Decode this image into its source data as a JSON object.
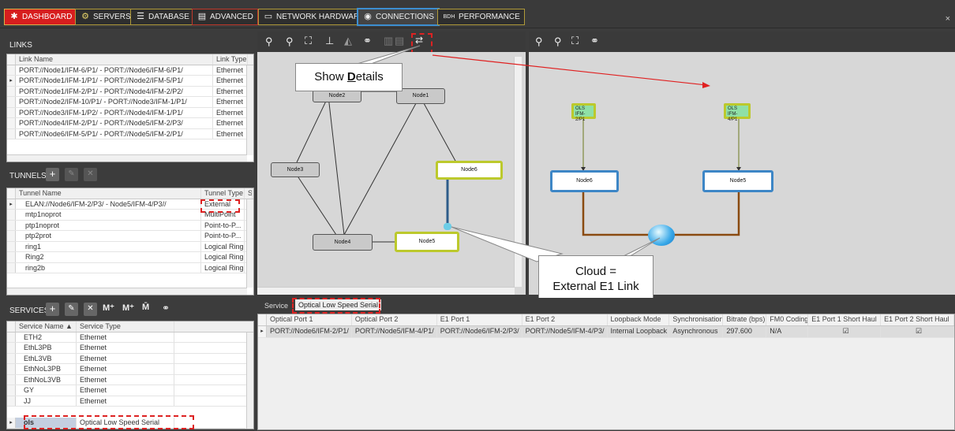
{
  "nav": [
    {
      "label": "DASHBOARD",
      "icon": "dashboard-icon"
    },
    {
      "label": "SERVERS",
      "icon": "gear-icon"
    },
    {
      "label": "DATABASE",
      "icon": "database-icon"
    },
    {
      "label": "ADVANCED",
      "icon": "document-icon"
    },
    {
      "label": "NETWORK HARDWARE",
      "icon": "network-icon"
    },
    {
      "label": "CONNECTIONS",
      "icon": "connections-icon"
    },
    {
      "label": "PERFORMANCE",
      "icon": "performance-icon"
    }
  ],
  "close": "×",
  "links": {
    "title": "LINKS",
    "columns": [
      "Link Name",
      "Link Type"
    ],
    "rows": [
      [
        "PORT://Node1/IFM-6/P1/ - PORT://Node6/IFM-6/P1/",
        "Ethernet"
      ],
      [
        "PORT://Node1/IFM-1/P1/ - PORT://Node2/IFM-5/P1/",
        "Ethernet"
      ],
      [
        "PORT://Node1/IFM-2/P1/ - PORT://Node4/IFM-2/P2/",
        "Ethernet"
      ],
      [
        "PORT://Node2/IFM-10/P1/ - PORT://Node3/IFM-1/P1/",
        "Ethernet"
      ],
      [
        "PORT://Node3/IFM-1/P2/ - PORT://Node4/IFM-1/P1/",
        "Ethernet"
      ],
      [
        "PORT://Node4/IFM-2/P1/ - PORT://Node5/IFM-2/P3/",
        "Ethernet"
      ],
      [
        "PORT://Node6/IFM-5/P1/ - PORT://Node5/IFM-2/P1/",
        "Ethernet"
      ]
    ]
  },
  "tunnels": {
    "title": "TUNNELS",
    "columns": [
      "Tunnel Name",
      "Tunnel Type",
      "S"
    ],
    "rows": [
      [
        "ELAN://Node6/IFM-2/P3/ - Node5/IFM-4/P3//",
        "External"
      ],
      [
        "mtp1noprot",
        "MultiPoint"
      ],
      [
        "ptp1noprot",
        "Point-to-P..."
      ],
      [
        "ptp2prot",
        "Point-to-P..."
      ],
      [
        "ring1",
        "Logical Ring"
      ],
      [
        "Ring2",
        "Logical Ring"
      ],
      [
        "ring2b",
        "Logical Ring"
      ]
    ]
  },
  "services": {
    "title": "SERVICES",
    "columns": [
      "Service Name",
      "Service Type"
    ],
    "rows": [
      [
        "ETH2",
        "Ethernet"
      ],
      [
        "EthL3PB",
        "Ethernet"
      ],
      [
        "EthL3VB",
        "Ethernet"
      ],
      [
        "EthNoL3PB",
        "Ethernet"
      ],
      [
        "EthNoL3VB",
        "Ethernet"
      ],
      [
        "GY",
        "Ethernet"
      ],
      [
        "JJ",
        "Ethernet"
      ],
      [
        "ols",
        "Optical Low Speed Serial"
      ]
    ]
  },
  "topology_left": {
    "nodes": [
      "Node2",
      "Node1",
      "Node3",
      "Node6",
      "Node4",
      "Node5"
    ]
  },
  "topology_right": {
    "ols": [
      [
        "OLS",
        "IFM-2/P1"
      ],
      [
        "OLS",
        "IFM-4/P1"
      ]
    ],
    "nodes": [
      "Node6",
      "Node5"
    ]
  },
  "callouts": {
    "show_details_pre": "Show ",
    "show_details_u": "D",
    "show_details_post": "etails",
    "cloud_line1": "Cloud =",
    "cloud_line2": "External E1 Link"
  },
  "bottom": {
    "tabs": [
      "Service",
      "Optical Low Speed Serial"
    ],
    "columns": [
      "Optical Port 1",
      "Optical Port 2",
      "E1 Port 1",
      "E1 Port 2",
      "Loopback Mode",
      "Synchronisation",
      "Bitrate (bps)",
      "FM0 Coding",
      "E1 Port 1 Short Haul",
      "E1 Port 2 Short Haul"
    ],
    "row": [
      "PORT://Node6/IFM-2/P1/",
      "PORT://Node5/IFM-4/P1/",
      "PORT://Node6/IFM-2/P3/",
      "PORT://Node5/IFM-4/P3/",
      "Internal Loopback",
      "Asynchronous",
      "297.600",
      "N/A",
      "☑",
      "☑"
    ]
  }
}
